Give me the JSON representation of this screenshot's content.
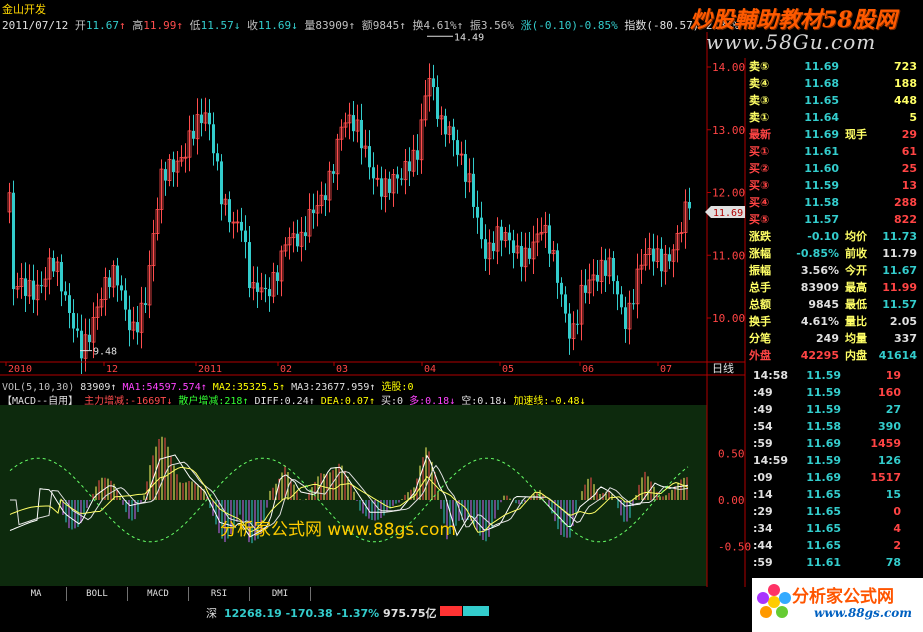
{
  "header": {
    "title": "金山开发",
    "date": "2011/07/12",
    "open_label": "开",
    "open": "11.67",
    "high_label": "高",
    "high": "11.99",
    "low_label": "低",
    "low": "11.57",
    "close_label": "收",
    "close": "11.69",
    "volume_label": "量",
    "volume": "83909",
    "amount_label": "额",
    "amount": "9845",
    "turnover_label": "换",
    "turnover": "4.61%",
    "amplitude_label": "振",
    "amplitude": "3.56%",
    "change_label": "涨",
    "change": "(-0.10)-0.85%",
    "index_label": "指数",
    "index": "(-80.57)-2.84%"
  },
  "watermark": {
    "title": "炒股輔助教材58股网",
    "url": "www.58Gu.com"
  },
  "price_axis": [
    "14.00",
    "13.00",
    "12.00",
    "11.00",
    "10.00"
  ],
  "price_marks": {
    "high": "14.49",
    "low": "9.48",
    "current": "11.69"
  },
  "date_axis": [
    "2010",
    "12",
    "2011",
    "02",
    "03",
    "04",
    "05",
    "06",
    "07"
  ],
  "period_label": "日线",
  "vol_line": {
    "label": "VOL(5,10,30)",
    "vol": "83909",
    "ma1": "MA1:54597.574",
    "ma2": "MA2:35325.5",
    "ma3": "MA3:23677.959",
    "pick": "选股:0"
  },
  "macd_line": {
    "name": "【MACD--自用】",
    "main": "主力增减:-1669T",
    "retail": "散户增减:218",
    "diff": "DIFF:0.24",
    "dea": "DEA:0.07",
    "buy": "买:0",
    "bull": "多:0.18",
    "bear": "空:0.18",
    "accel": "加速线:-0.48"
  },
  "macd_axis": [
    "0.50",
    "0.00",
    "-0.50"
  ],
  "mid_watermark": "分析家公式网 www.88gs.com",
  "order_book": {
    "sells": [
      {
        "label": "卖⑤",
        "price": "11.69",
        "vol": "723"
      },
      {
        "label": "卖④",
        "price": "11.68",
        "vol": "188"
      },
      {
        "label": "卖③",
        "price": "11.65",
        "vol": "448"
      },
      {
        "label": "卖①",
        "price": "11.64",
        "vol": "5"
      }
    ],
    "latest": {
      "label": "最新",
      "price": "11.69",
      "label2": "现手",
      "vol": "29"
    },
    "buys": [
      {
        "label": "买①",
        "price": "11.61",
        "vol": "61"
      },
      {
        "label": "买②",
        "price": "11.60",
        "vol": "25"
      },
      {
        "label": "买③",
        "price": "11.59",
        "vol": "13"
      },
      {
        "label": "买④",
        "price": "11.58",
        "vol": "288"
      },
      {
        "label": "买⑤",
        "price": "11.57",
        "vol": "822"
      }
    ]
  },
  "stats": [
    {
      "l1": "涨跌",
      "v1": "-0.10",
      "l2": "均价",
      "v2": "11.73"
    },
    {
      "l1": "涨幅",
      "v1": "-0.85%",
      "l2": "前收",
      "v2": "11.79"
    },
    {
      "l1": "振幅",
      "v1": "3.56%",
      "l2": "今开",
      "v2": "11.67"
    },
    {
      "l1": "总手",
      "v1": "83909",
      "l2": "最高",
      "v2": "11.99"
    },
    {
      "l1": "总额",
      "v1": "9845",
      "l2": "最低",
      "v2": "11.57"
    },
    {
      "l1": "换手",
      "v1": "4.61%",
      "l2": "量比",
      "v2": "2.05"
    },
    {
      "l1": "分笔",
      "v1": "249",
      "l2": "均量",
      "v2": "337"
    }
  ],
  "outer_inner": {
    "l1": "外盘",
    "v1": "42295",
    "l2": "内盘",
    "v2": "41614"
  },
  "ticks": [
    {
      "time": "14:58",
      "price": "11.59",
      "vol": "19"
    },
    {
      "time": ":49",
      "price": "11.59",
      "vol": "160"
    },
    {
      "time": ":49",
      "price": "11.59",
      "vol": "27"
    },
    {
      "time": ":54",
      "price": "11.58",
      "vol": "390"
    },
    {
      "time": ":59",
      "price": "11.69",
      "vol": "1459"
    },
    {
      "time": "14:59",
      "price": "11.59",
      "vol": "126"
    },
    {
      "time": ":09",
      "price": "11.69",
      "vol": "1517"
    },
    {
      "time": ":14",
      "price": "11.65",
      "vol": "15"
    },
    {
      "time": ":29",
      "price": "11.65",
      "vol": "0"
    },
    {
      "time": ":34",
      "price": "11.65",
      "vol": "4"
    },
    {
      "time": ":44",
      "price": "11.65",
      "vol": "2"
    },
    {
      "time": ":59",
      "price": "11.61",
      "vol": "78"
    }
  ],
  "tabs": [
    "MA",
    "BOLL",
    "MACD",
    "RSI",
    "DMI"
  ],
  "status": {
    "market": "深",
    "index": "12268.19",
    "change": "-170.38",
    "pct": "-1.37%",
    "amount": "975.75亿"
  },
  "logo": {
    "title": "分析家公式网",
    "url": "www.88gs.com"
  },
  "colors": {
    "up": "#ff4d4d",
    "down": "#33cccc",
    "axis": "#b00000",
    "macd_bg": "#0d2a0d"
  }
}
